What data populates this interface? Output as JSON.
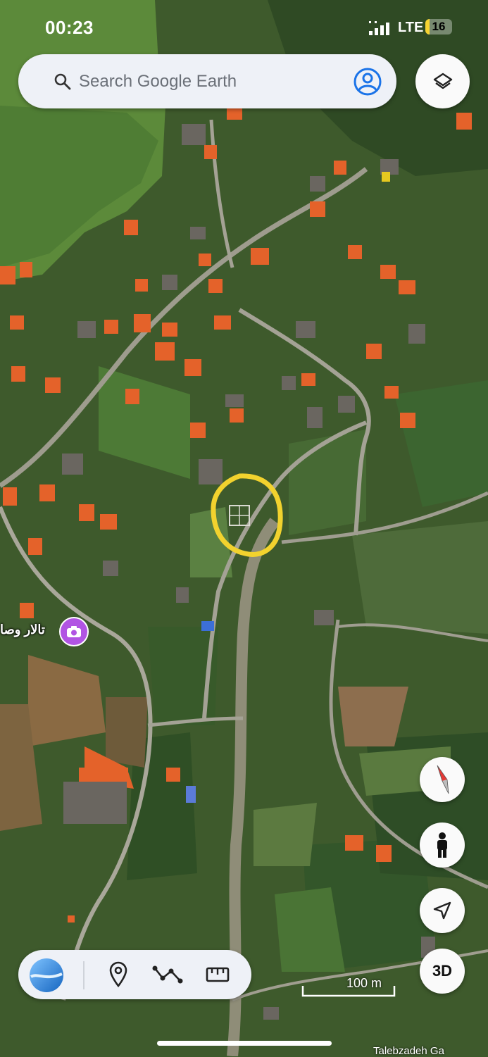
{
  "status_bar": {
    "time": "00:23",
    "network": "LTE",
    "battery": "16",
    "battery_level": 0.16
  },
  "search": {
    "placeholder": "Search Google Earth",
    "search_icon": "search-icon",
    "account_icon": "account-circle-icon"
  },
  "buttons": {
    "layers_icon": "layers-icon",
    "compass_icon": "compass-icon",
    "pegman_icon": "pegman-icon",
    "locate_icon": "navigation-arrow-icon",
    "three_d_label": "3D"
  },
  "toolbar": {
    "items": [
      "earth-logo-icon",
      "place-pin-icon",
      "path-icon",
      "ruler-icon"
    ]
  },
  "map": {
    "poi_label": "تالار وصا",
    "poi_icon": "camera-icon",
    "scale_label": "100 m",
    "attribution": "Talebzadeh Ga",
    "highlight_color": "#f2d22e"
  }
}
